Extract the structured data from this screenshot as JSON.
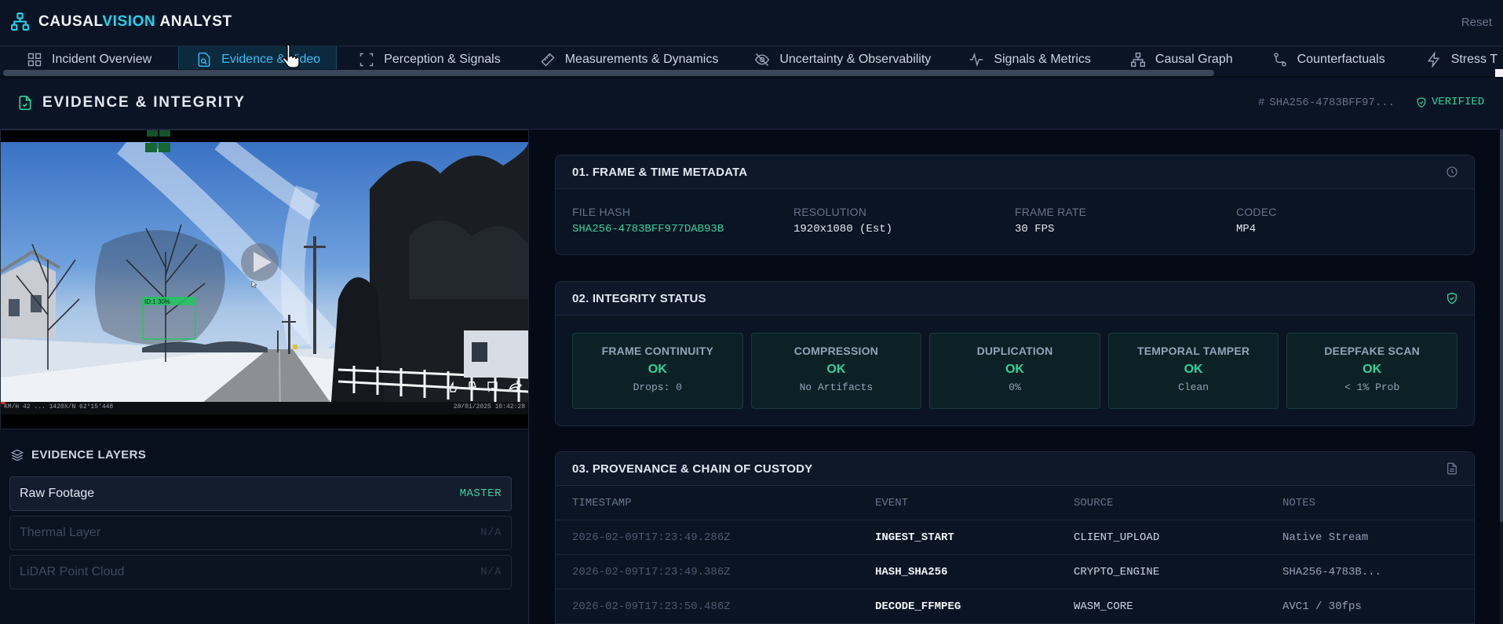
{
  "app": {
    "brand_prefix": "CAUSAL",
    "brand_accent": "VISION",
    "brand_suffix": " ANALYST",
    "reset_label": "Reset"
  },
  "tabs": [
    {
      "label": "Incident Overview",
      "icon": "grid-icon",
      "active": false
    },
    {
      "label": "Evidence & Video",
      "icon": "file-search-icon",
      "active": true
    },
    {
      "label": "Perception & Signals",
      "icon": "scan-frame-icon",
      "active": false
    },
    {
      "label": "Measurements & Dynamics",
      "icon": "ruler-icon",
      "active": false
    },
    {
      "label": "Uncertainty & Observability",
      "icon": "eye-off-icon",
      "active": false
    },
    {
      "label": "Signals & Metrics",
      "icon": "pulse-icon",
      "active": false
    },
    {
      "label": "Causal Graph",
      "icon": "network-icon",
      "active": false
    },
    {
      "label": "Counterfactuals",
      "icon": "route-icon",
      "active": false
    },
    {
      "label": "Stress T",
      "icon": "lightning-icon",
      "active": false
    }
  ],
  "section": {
    "title": "EVIDENCE & INTEGRITY",
    "hash_symbol": "#",
    "hash_short": "SHA256-4783BFF97...",
    "verified_label": "VERIFIED"
  },
  "video": {
    "detection_label": "ID:1 30%",
    "overlay_left": "KM/H 42 ... 1420X/N 62°15'448",
    "overlay_right": "28/01/2025 10:42:28",
    "controls": [
      "thumb-up-icon",
      "thumb-down-icon",
      "comment-icon",
      "share-icon"
    ]
  },
  "layers": {
    "title": "EVIDENCE LAYERS",
    "items": [
      {
        "name": "Raw Footage",
        "badge": "MASTER",
        "state": "active"
      },
      {
        "name": "Thermal Layer",
        "badge": "N/A",
        "state": "dim"
      },
      {
        "name": "LiDAR Point Cloud",
        "badge": "N/A",
        "state": "dim"
      }
    ]
  },
  "metadata": {
    "title": "01. FRAME & TIME METADATA",
    "fields": [
      {
        "label": "FILE HASH",
        "value": "SHA256-4783BFF977DAB93B",
        "highlight": true
      },
      {
        "label": "RESOLUTION",
        "value": "1920x1080 (Est)",
        "highlight": false
      },
      {
        "label": "FRAME RATE",
        "value": "30 FPS",
        "highlight": false
      },
      {
        "label": "CODEC",
        "value": "MP4",
        "highlight": false
      }
    ]
  },
  "integrity": {
    "title": "02. INTEGRITY STATUS",
    "checks": [
      {
        "label": "FRAME CONTINUITY",
        "status": "OK",
        "detail": "Drops: 0"
      },
      {
        "label": "COMPRESSION",
        "status": "OK",
        "detail": "No Artifacts"
      },
      {
        "label": "DUPLICATION",
        "status": "OK",
        "detail": "0%"
      },
      {
        "label": "TEMPORAL TAMPER",
        "status": "OK",
        "detail": "Clean"
      },
      {
        "label": "DEEPFAKE SCAN",
        "status": "OK",
        "detail": "< 1% Prob"
      }
    ]
  },
  "provenance": {
    "title": "03. PROVENANCE & CHAIN OF CUSTODY",
    "columns": [
      "TIMESTAMP",
      "EVENT",
      "SOURCE",
      "NOTES"
    ],
    "rows": [
      {
        "timestamp": "2026-02-09T17:23:49.286Z",
        "event": "INGEST_START",
        "source": "CLIENT_UPLOAD",
        "notes": "Native Stream"
      },
      {
        "timestamp": "2026-02-09T17:23:49.386Z",
        "event": "HASH_SHA256",
        "source": "CRYPTO_ENGINE",
        "notes": "SHA256-4783B..."
      },
      {
        "timestamp": "2026-02-09T17:23:50.486Z",
        "event": "DECODE_FFMPEG",
        "source": "WASM_CORE",
        "notes": "AVC1 / 30fps"
      }
    ]
  },
  "colors": {
    "accent": "#22d3ee",
    "ok": "#34d399",
    "background": "#050b16"
  }
}
